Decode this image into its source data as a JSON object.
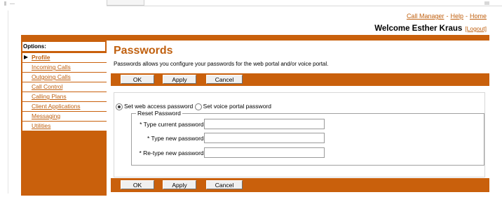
{
  "header": {
    "links": [
      "Call Manager",
      "Help",
      "Home"
    ],
    "separator": "-",
    "welcome_text": "Welcome Esther Kraus",
    "logout_label": "[Logout]"
  },
  "sidebar": {
    "title": "Options:",
    "items": [
      {
        "label": "Profile",
        "active": true
      },
      {
        "label": "Incoming Calls"
      },
      {
        "label": "Outgoing Calls"
      },
      {
        "label": "Call Control"
      },
      {
        "label": "Calling Plans"
      },
      {
        "label": "Client Applications"
      },
      {
        "label": "Messaging"
      },
      {
        "label": "Utilities"
      }
    ]
  },
  "main": {
    "title": "Passwords",
    "description": "Passwords allows you configure your passwords for the web portal and/or voice portal.",
    "buttons": {
      "ok": "OK",
      "apply": "Apply",
      "cancel": "Cancel"
    },
    "radio_options": [
      {
        "label": "Set web access password",
        "selected": true
      },
      {
        "label": "Set voice portal password",
        "selected": false
      }
    ],
    "fieldset": {
      "legend": "Reset Password",
      "fields": [
        {
          "label": "* Type current password:",
          "value": ""
        },
        {
          "label": "* Type new password:",
          "value": ""
        },
        {
          "label": "* Re-type new password:",
          "value": ""
        }
      ]
    }
  },
  "colors": {
    "accent": "#c9600c",
    "link": "#c0600f"
  }
}
